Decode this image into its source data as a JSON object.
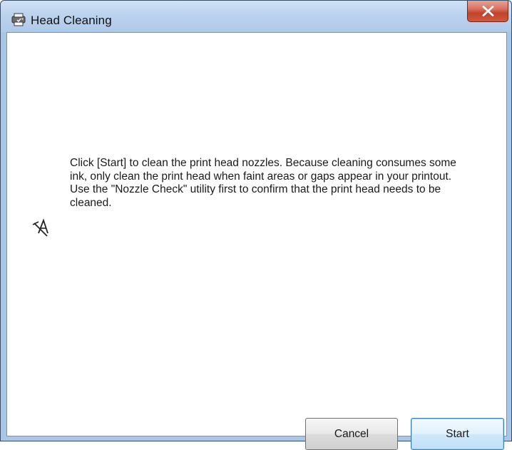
{
  "window": {
    "title": "Head Cleaning",
    "title_icon": "printer-head-icon",
    "close_icon": "close-icon"
  },
  "dialog": {
    "message": "Click [Start] to clean the print head nozzles. Because cleaning consumes some ink, only clean the print head when faint areas or gaps appear in your printout. Use the \"Nozzle Check\" utility first to confirm that the print head needs to be cleaned.",
    "side_icon": "head-cleaning-icon"
  },
  "buttons": {
    "cancel_label": "Cancel",
    "start_label": "Start"
  },
  "colors": {
    "titlebar": "#bcd3ee",
    "close_button": "#c9503a",
    "default_button_border": "#3c7fb1"
  }
}
